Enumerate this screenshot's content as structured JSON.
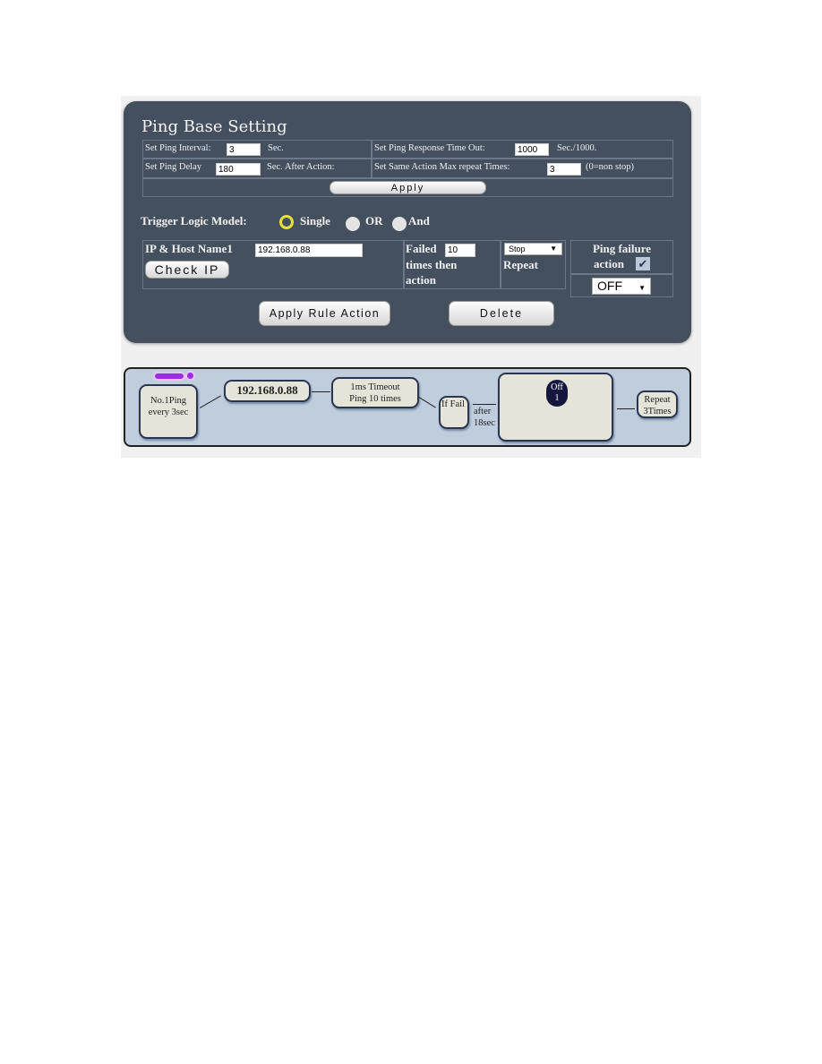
{
  "ping_base": {
    "title": "Ping Base Setting",
    "interval_label": "Set Ping Interval:",
    "interval_value": "3",
    "interval_unit": "Sec.",
    "timeout_label": "Set Ping Response Time Out:",
    "timeout_value": "1000",
    "timeout_unit": "Sec./1000.",
    "delay_label": "Set Ping Delay",
    "delay_value": "180",
    "delay_unit": "Sec. After Action:",
    "repeat_label": "Set Same Action Max repeat Times:",
    "repeat_value": "3",
    "repeat_note": "(0=non stop)",
    "apply_label": "Apply"
  },
  "trigger": {
    "label": "Trigger Logic Model:",
    "options": [
      {
        "label": "Single",
        "selected": true
      },
      {
        "label": "OR",
        "selected": false
      },
      {
        "label": "And",
        "selected": false
      }
    ]
  },
  "rule": {
    "host_label": "IP & Host Name1",
    "host_value": "192.168.0.88",
    "check_ip_label": "Check IP",
    "failed_label_1": "Failed",
    "failed_value": "10",
    "failed_label_2": "times then",
    "failed_label_3": "action",
    "repeat_select": "Stop",
    "repeat_label": "Repeat",
    "failure_action_label_1": "Ping failure",
    "failure_action_label_2": "action",
    "failure_action_checked": true,
    "failure_action_select": "OFF",
    "apply_rule_label": "Apply Rule Action",
    "delete_label": "Delete"
  },
  "diagram": {
    "ping_node": [
      "No.1Ping",
      "every 3sec"
    ],
    "ip_node": "192.168.0.88",
    "timeout_node": [
      "1ms Timeout",
      "Ping 10 times"
    ],
    "if_fail_node": "If Fail",
    "after_text": [
      "after",
      "18sec"
    ],
    "action_badge": [
      "Off",
      "1"
    ],
    "repeat_node": [
      "Repeat",
      "3Times"
    ],
    "colors": {
      "indicator": "#9a2ee0",
      "badge": "#14163e"
    }
  }
}
